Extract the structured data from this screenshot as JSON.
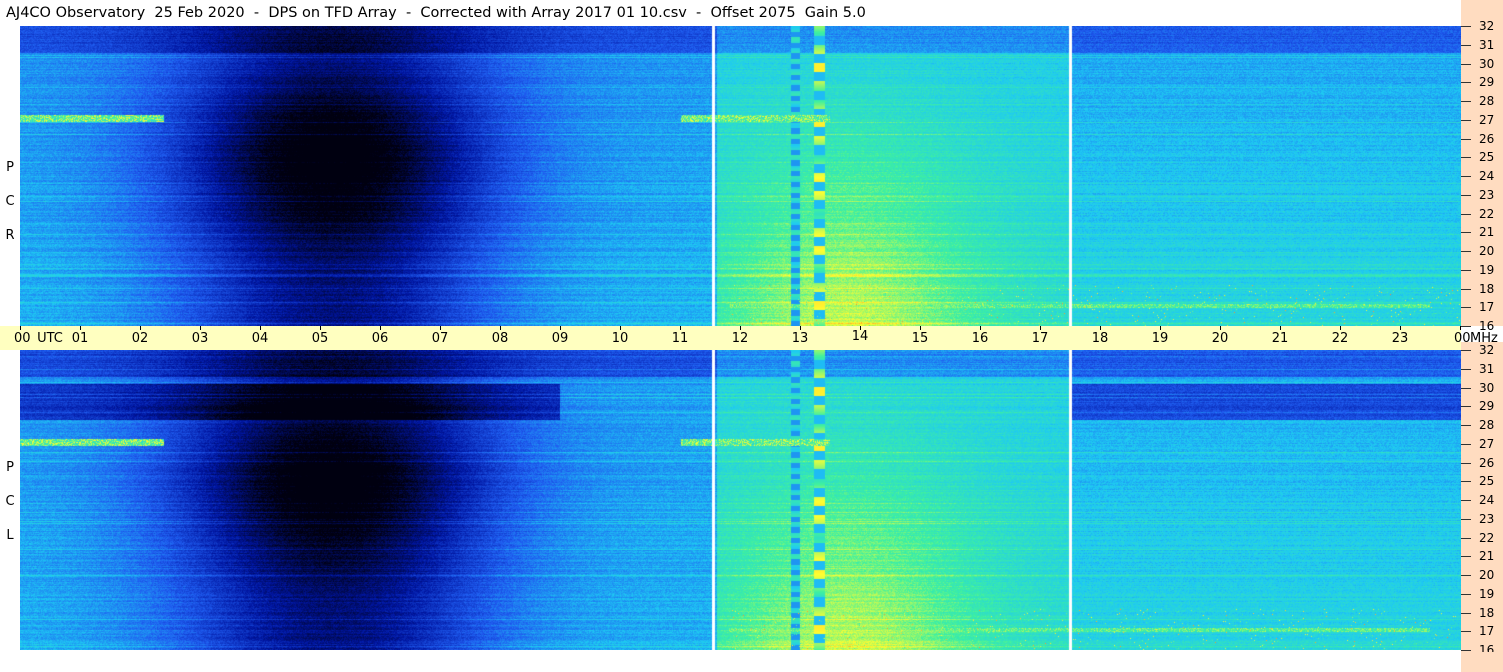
{
  "header": {
    "title": "AJ4CO Observatory  25 Feb 2020  -  DPS on TFD Array  -  Corrected with Array 2017 01 10.csv  -  Offset 2075  Gain 5.0"
  },
  "chart_data": {
    "type": "heatmap",
    "title": "AJ4CO Observatory  25 Feb 2020  -  DPS on TFD Array  -  Corrected with Array 2017 01 10.csv  -  Offset 2075  Gain 5.0",
    "x_axis": {
      "unit_label": "UTC",
      "ticks": [
        "00",
        "01",
        "02",
        "03",
        "04",
        "05",
        "06",
        "07",
        "08",
        "09",
        "10",
        "11",
        "12",
        "13",
        "14",
        "15",
        "16",
        "17",
        "18",
        "19",
        "20",
        "21",
        "22",
        "23",
        "00"
      ],
      "range_hours": [
        0,
        24
      ]
    },
    "y_axis": {
      "unit_label": "MHz",
      "ticks": [
        "32",
        "31",
        "30",
        "29",
        "28",
        "27",
        "26",
        "25",
        "24",
        "23",
        "22",
        "21",
        "20",
        "19",
        "18",
        "17",
        "16"
      ],
      "range_mhz": [
        16,
        32
      ]
    },
    "panels": [
      {
        "polarization": "RCP",
        "letters": [
          "R",
          "C",
          "P"
        ]
      },
      {
        "polarization": "LCP",
        "letters": [
          "L",
          "C",
          "P"
        ]
      }
    ],
    "separator_times_utc_hours": [
      11.55,
      17.5
    ],
    "colormap": [
      "#000010",
      "#0015a0",
      "#1f5cf0",
      "#1ec9f4",
      "#3ef0a0",
      "#ffff30",
      "#ff6020"
    ]
  }
}
